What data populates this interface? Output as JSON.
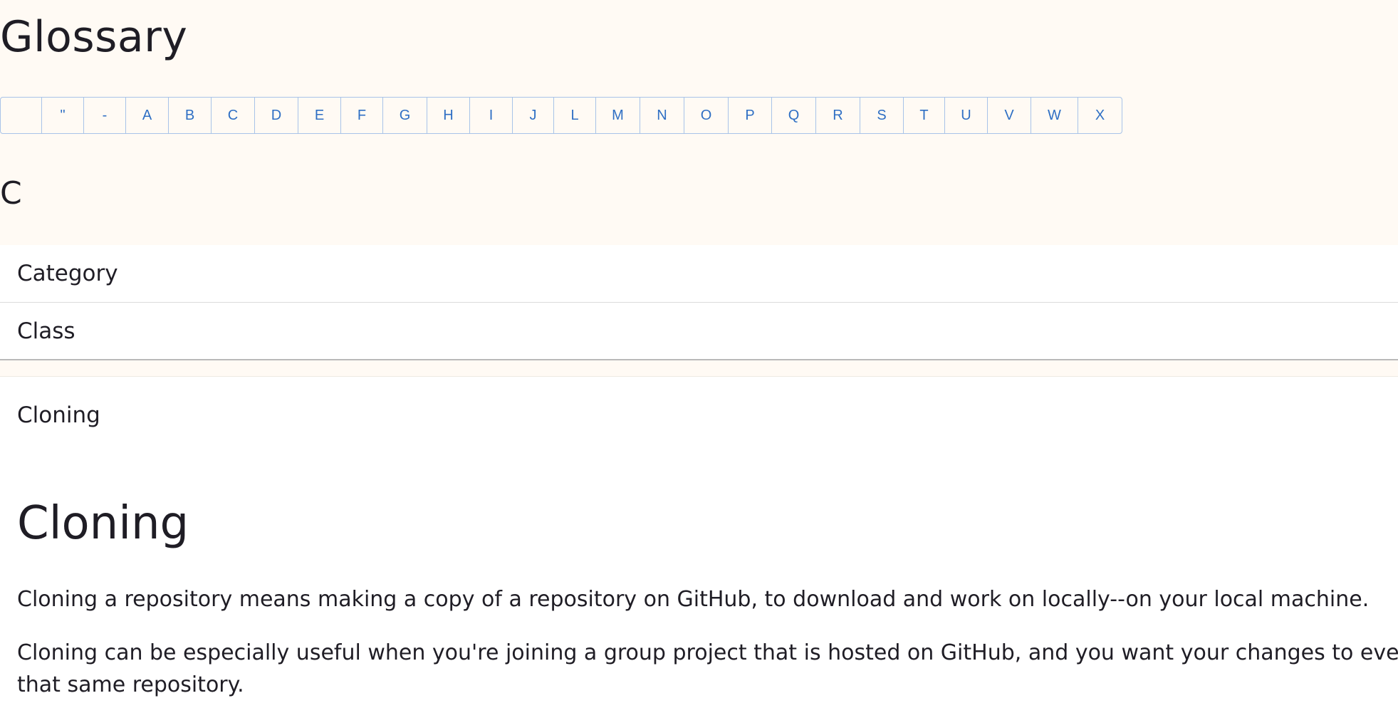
{
  "header": {
    "title": "Glossary"
  },
  "letter_nav": {
    "items": [
      " ",
      "\"",
      "-",
      "A",
      "B",
      "C",
      "D",
      "E",
      "F",
      "G",
      "H",
      "I",
      "J",
      "L",
      "M",
      "N",
      "O",
      "P",
      "Q",
      "R",
      "S",
      "T",
      "U",
      "V",
      "W",
      "X"
    ]
  },
  "section": {
    "letter": "C",
    "terms": [
      "Category",
      "Class"
    ]
  },
  "detail": {
    "term": "Cloning",
    "heading": "Cloning",
    "paragraph_1": "Cloning a repository means making a copy of a repository on GitHub, to download and work on locally--on your local machine.",
    "paragraph_2_line_1": "Cloning can be especially useful when you're joining a group project that is hosted on GitHub, and you want your changes to eve",
    "paragraph_2_line_2": "that same repository."
  },
  "colors": {
    "page_background": "#fffaf4",
    "link_blue": "#2f6fc4",
    "nav_border": "#a8c3e8",
    "text": "#1f1d25"
  }
}
